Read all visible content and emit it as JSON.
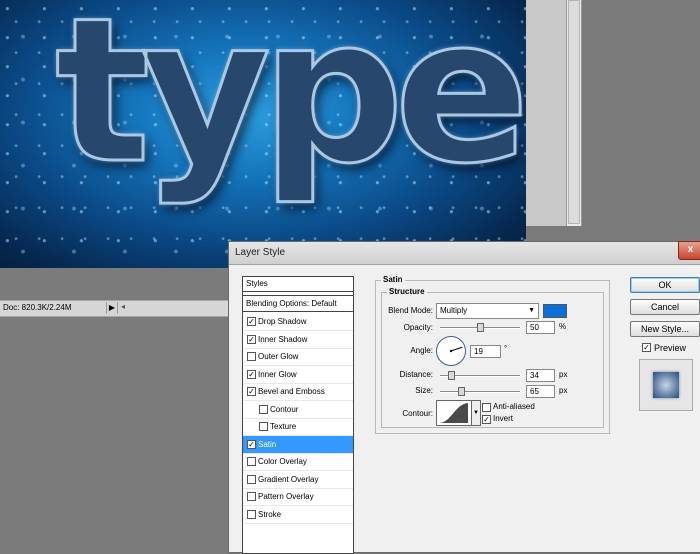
{
  "canvas": {
    "word": "type"
  },
  "statusbar": {
    "doc_info": "Doc: 820.3K/2.24M",
    "arrow": "▶",
    "scroll_left": "◂"
  },
  "dialog": {
    "title": "Layer Style",
    "close_label": "x",
    "styles_panel": {
      "header": "Styles",
      "blending_options": "Blending Options: Default",
      "items": [
        {
          "label": "Drop Shadow",
          "checked": true
        },
        {
          "label": "Inner Shadow",
          "checked": true
        },
        {
          "label": "Outer Glow",
          "checked": false
        },
        {
          "label": "Inner Glow",
          "checked": true
        },
        {
          "label": "Bevel and Emboss",
          "checked": true
        },
        {
          "label": "Contour",
          "checked": false
        },
        {
          "label": "Texture",
          "checked": false
        },
        {
          "label": "Satin",
          "checked": true,
          "selected": true
        },
        {
          "label": "Color Overlay",
          "checked": false
        },
        {
          "label": "Gradient Overlay",
          "checked": false
        },
        {
          "label": "Pattern Overlay",
          "checked": false
        },
        {
          "label": "Stroke",
          "checked": false
        }
      ]
    },
    "satin": {
      "section_title": "Satin",
      "structure_title": "Structure",
      "blend_mode_label": "Blend Mode:",
      "blend_mode_value": "Multiply",
      "color": "#0a6fd6",
      "opacity_label": "Opacity:",
      "opacity_value": "50",
      "opacity_unit": "%",
      "opacity_fraction": 0.5,
      "angle_label": "Angle:",
      "angle_value": "19",
      "angle_unit": "°",
      "distance_label": "Distance:",
      "distance_value": "34",
      "distance_unit": "px",
      "distance_fraction": 0.14,
      "size_label": "Size:",
      "size_value": "65",
      "size_unit": "px",
      "size_fraction": 0.26,
      "contour_label": "Contour:",
      "anti_aliased_label": "Anti-aliased",
      "anti_aliased_checked": false,
      "invert_label": "Invert",
      "invert_checked": true
    },
    "buttons": {
      "ok": "OK",
      "cancel": "Cancel",
      "new_style": "New Style..."
    },
    "preview": {
      "label": "Preview",
      "checked": true
    }
  }
}
